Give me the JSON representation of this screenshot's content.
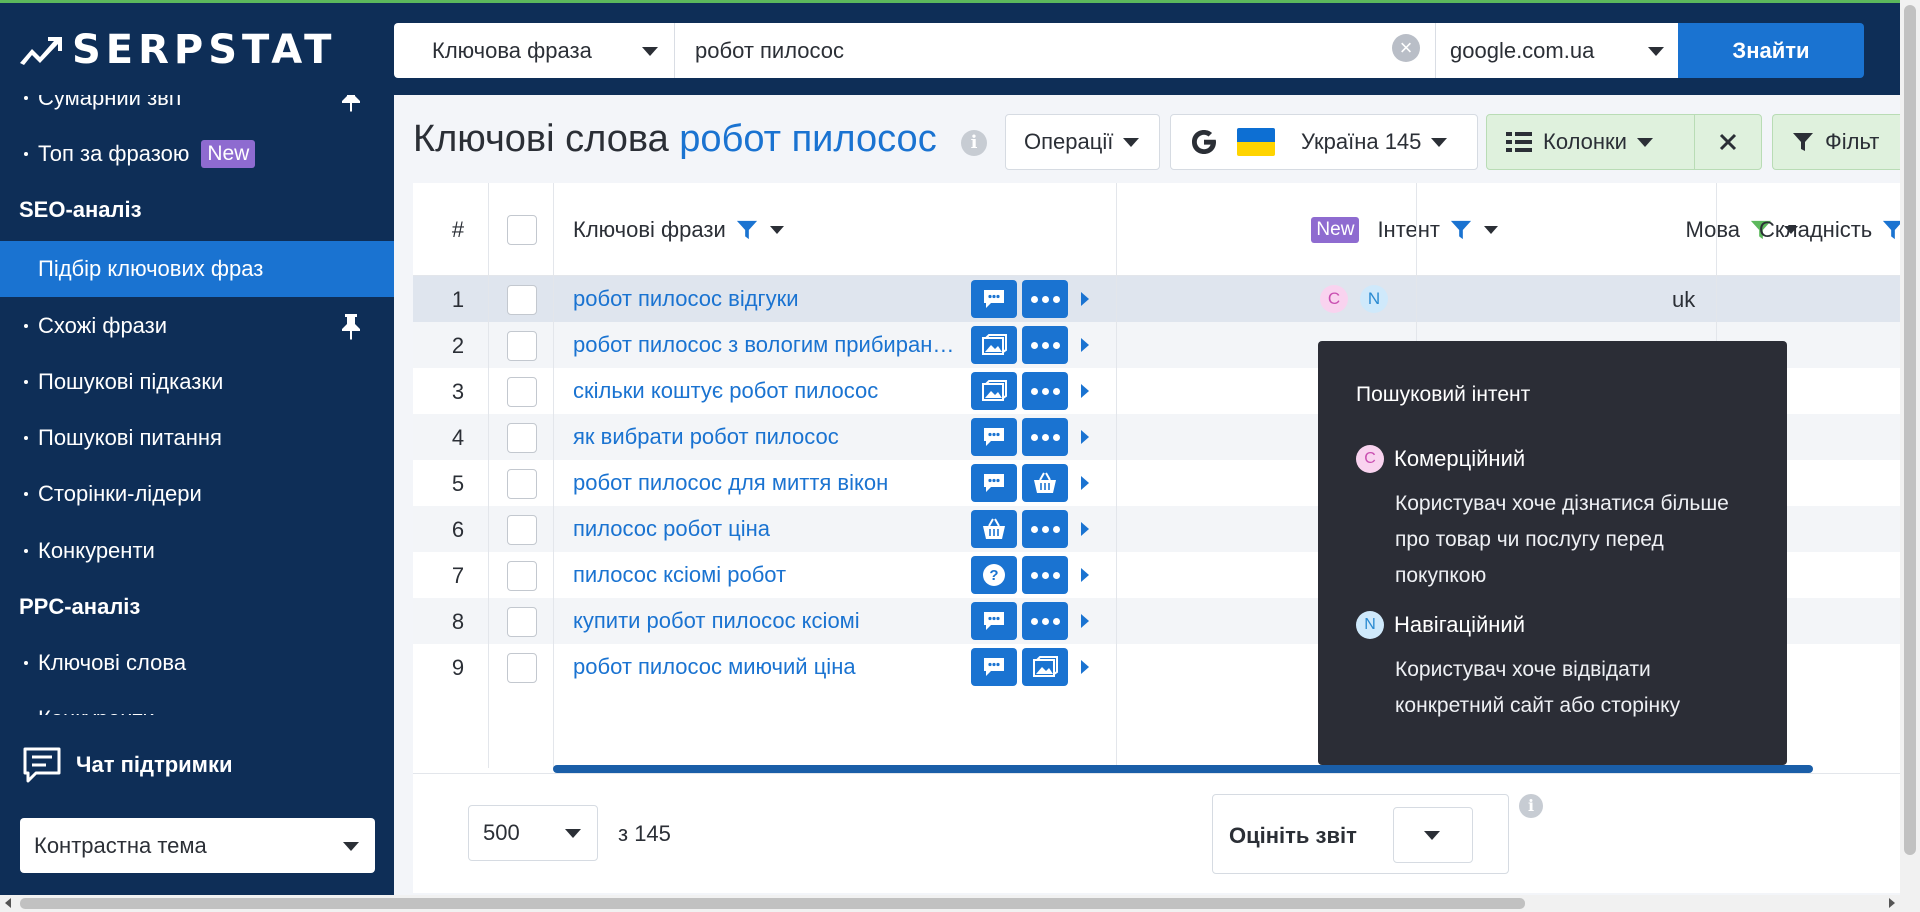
{
  "brand": "SERPSTAT",
  "search": {
    "type_label": "Ключова фраза",
    "query": "робот пилосос",
    "engine": "google.com.ua",
    "submit_label": "Знайти"
  },
  "sidebar": {
    "items": [
      {
        "label": "Сумарний звіт",
        "kind": "item",
        "pinned": true
      },
      {
        "label": "Топ за фразою",
        "kind": "item",
        "badge": "New"
      },
      {
        "label": "SEO-аналіз",
        "kind": "section"
      },
      {
        "label": "Підбір ключових фраз",
        "kind": "active"
      },
      {
        "label": "Схожі фрази",
        "kind": "item",
        "pinned": true
      },
      {
        "label": "Пошукові підказки",
        "kind": "item"
      },
      {
        "label": "Пошукові питання",
        "kind": "item"
      },
      {
        "label": "Сторінки-лідери",
        "kind": "item"
      },
      {
        "label": "Конкуренти",
        "kind": "item"
      },
      {
        "label": "PPC-аналіз",
        "kind": "section"
      },
      {
        "label": "Ключові слова",
        "kind": "item"
      },
      {
        "label": "Конкуренти",
        "kind": "item"
      }
    ],
    "chat_label": "Чат підтримки",
    "theme_label": "Контрастна тема"
  },
  "page": {
    "title_prefix": "Ключові слова",
    "title_keyword": "робот пилосос"
  },
  "toolbar": {
    "operations": "Операції",
    "region": "Україна 145",
    "columns": "Колонки",
    "filters": "Фільт"
  },
  "table": {
    "headers": {
      "num": "#",
      "keywords": "Ключові фрази",
      "intent_badge": "New",
      "intent": "Інтент",
      "language": "Мова",
      "difficulty": "Складність"
    },
    "rows": [
      {
        "num": "1",
        "keyword": "робот пилосос відгуки",
        "icons": [
          "chat",
          "dots"
        ],
        "intents": [
          "C",
          "N"
        ],
        "lang": "uk"
      },
      {
        "num": "2",
        "keyword": "робот пилосос з вологим прибиранням",
        "icons": [
          "image",
          "dots"
        ]
      },
      {
        "num": "3",
        "keyword": "скільки коштує робот пилосос",
        "icons": [
          "image",
          "dots"
        ]
      },
      {
        "num": "4",
        "keyword": "як вибрати робот пилосос",
        "icons": [
          "chat",
          "dots"
        ]
      },
      {
        "num": "5",
        "keyword": "робот пилосос для миття вікон",
        "icons": [
          "chat",
          "basket"
        ]
      },
      {
        "num": "6",
        "keyword": "пилосос робот ціна",
        "icons": [
          "basket",
          "dots"
        ]
      },
      {
        "num": "7",
        "keyword": "пилосос ксіомі робот",
        "icons": [
          "question",
          "dots"
        ]
      },
      {
        "num": "8",
        "keyword": "купити робот пилосос ксіомі",
        "icons": [
          "chat",
          "dots"
        ]
      },
      {
        "num": "9",
        "keyword": "робот пилосос миючий ціна",
        "icons": [
          "chat",
          "image"
        ]
      }
    ]
  },
  "tooltip": {
    "title": "Пошуковий інтент",
    "items": [
      {
        "letter": "C",
        "name": "Комерційний",
        "desc": "Користувач хоче дізнатися більше про товар чи послугу перед покупкою"
      },
      {
        "letter": "N",
        "name": "Навігаційний",
        "desc": "Користувач хоче відвідати конкретний сайт або сторінку"
      }
    ]
  },
  "footer": {
    "page_size": "500",
    "of_total": "з 145",
    "rate_label": "Оцініть звіт"
  },
  "colors": {
    "navy": "#0e2e57",
    "accent": "#1a73d1",
    "new_badge": "#8e6bd0"
  }
}
